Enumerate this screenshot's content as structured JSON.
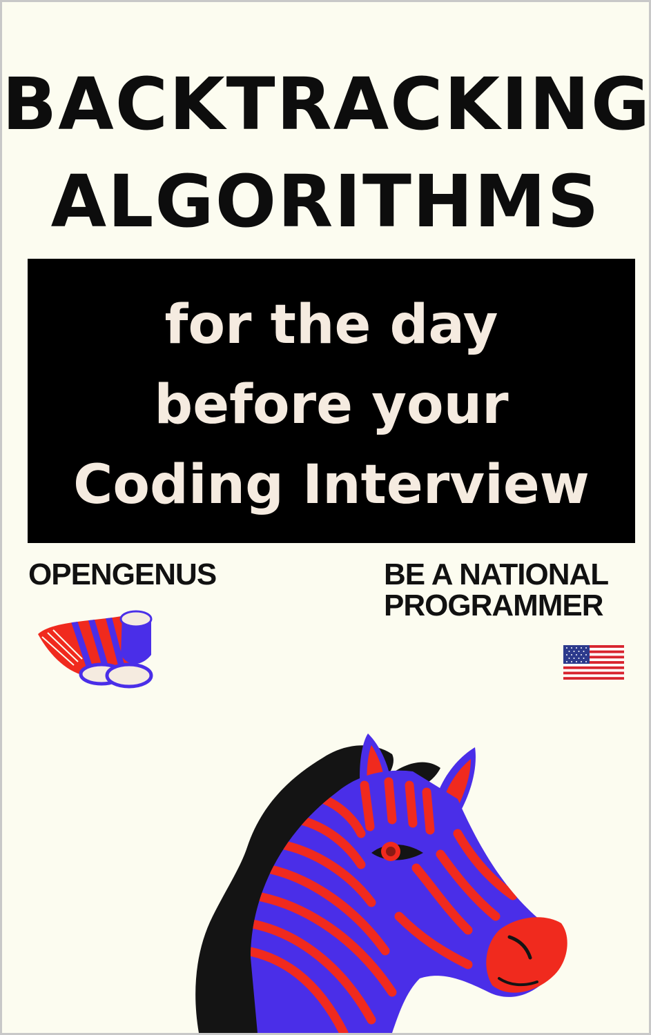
{
  "cover": {
    "title_lines": [
      "BACKTRACKING",
      "ALGORITHMS"
    ],
    "subtitle_lines": [
      "for the day",
      "before your",
      "Coding Interview"
    ],
    "publisher": "OPENGENUS",
    "series_lines": [
      "BE A NATIONAL",
      "PROGRAMMER"
    ],
    "colors": {
      "background": "#fcfcf0",
      "text": "#0d0d0d",
      "subtitle_box": "#000000",
      "subtitle_text": "#f5ebe0",
      "zebra_body": "#4a2ee8",
      "zebra_stripes": "#f02a1e",
      "mane": "#141414"
    },
    "icons": {
      "logo": "opengenus-logo-icon",
      "flag": "us-flag-icon",
      "illustration": "zebra-head-icon"
    }
  }
}
